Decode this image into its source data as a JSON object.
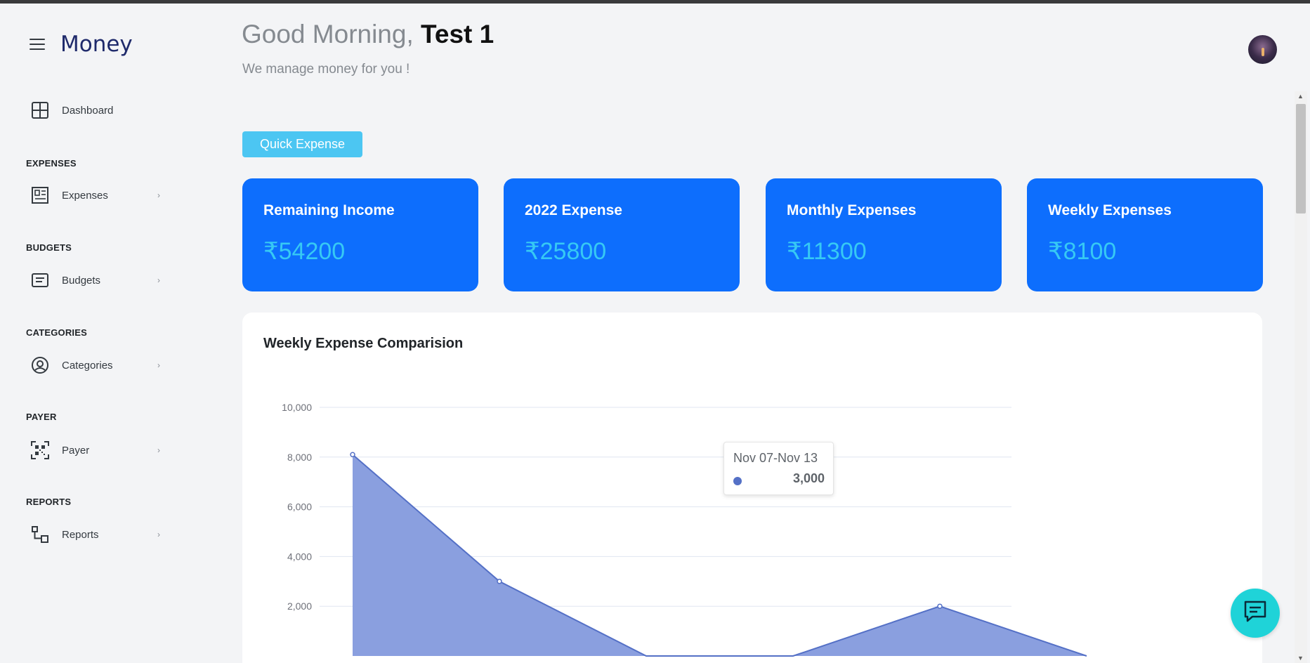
{
  "app": {
    "brand": "Money"
  },
  "sidebar": {
    "dashboard": {
      "label": "Dashboard",
      "icon": "dashboard-grid-icon"
    },
    "sections": [
      {
        "title": "EXPENSES",
        "item": {
          "label": "Expenses",
          "icon": "expenses-icon"
        }
      },
      {
        "title": "BUDGETS",
        "item": {
          "label": "Budgets",
          "icon": "budgets-icon"
        }
      },
      {
        "title": "CATEGORIES",
        "item": {
          "label": "Categories",
          "icon": "user-circle-icon"
        }
      },
      {
        "title": "PAYER",
        "item": {
          "label": "Payer",
          "icon": "qr-code-icon"
        }
      },
      {
        "title": "REPORTS",
        "item": {
          "label": "Reports",
          "icon": "reports-icon"
        }
      }
    ],
    "chevron": "›"
  },
  "header": {
    "greeting": "Good Morning,",
    "user_name": "Test 1",
    "subtitle": "We manage money for you !"
  },
  "quick_expense_label": "Quick Expense",
  "cards": [
    {
      "title": "Remaining Income",
      "value": "₹54200"
    },
    {
      "title": "2022 Expense",
      "value": "₹25800"
    },
    {
      "title": "Monthly Expenses",
      "value": "₹11300"
    },
    {
      "title": "Weekly Expenses",
      "value": "₹8100"
    }
  ],
  "chart_panel": {
    "title": "Weekly Expense Comparision",
    "tooltip": {
      "title": "Nov 07-Nov 13",
      "value": "3,000"
    }
  },
  "chart_data": {
    "type": "area",
    "title": "Weekly Expense Comparision",
    "xlabel": "",
    "ylabel": "",
    "ylim": [
      0,
      10000
    ],
    "y_ticks": [
      "10,000",
      "8,000",
      "6,000",
      "4,000",
      "2,000"
    ],
    "x_index": [
      0,
      1,
      2,
      3,
      4,
      5
    ],
    "values": [
      8100,
      3000,
      0,
      0,
      2000,
      0
    ],
    "color": "#5470c6",
    "fill": "#8a9fdf",
    "grid": true
  },
  "colors": {
    "card_bg": "#0d6efd",
    "card_value": "#36c9f4",
    "quick_btn": "#4cc6f2",
    "chat_fab": "#1fd3d8",
    "brand": "#1f2a6b"
  },
  "icons": {
    "menu": "hamburger-icon",
    "chat": "chat-icon",
    "avatar": "user-avatar"
  }
}
